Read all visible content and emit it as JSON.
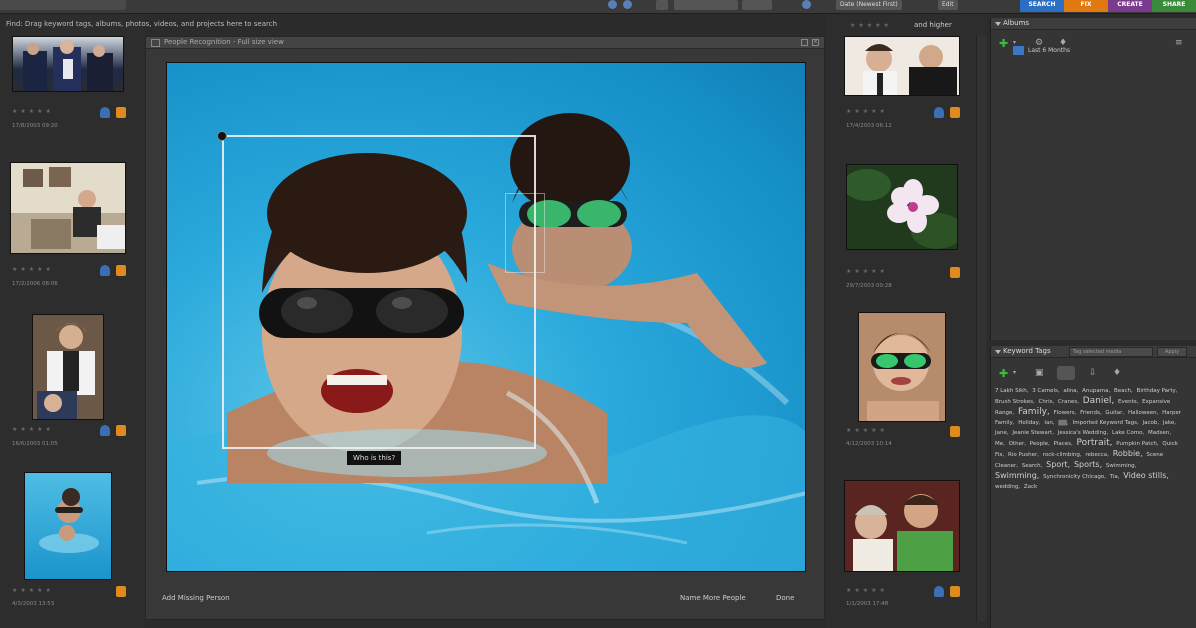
{
  "app": {
    "mode_tabs": [
      {
        "label": "SEARCH",
        "color": "#2a6fc4"
      },
      {
        "label": "FIX",
        "color": "#e07a10"
      },
      {
        "label": "CREATE",
        "color": "#7a3a8e"
      },
      {
        "label": "SHARE",
        "color": "#3a8a3a"
      }
    ],
    "top_sort_label": "Date (Newest First)",
    "top_edit_label": "Edit"
  },
  "organizer": {
    "drag_hint": "Find: Drag keyword tags, albums, photos, videos, and projects here to search",
    "rating_filter_label": "and higher",
    "stars": "★★★★★"
  },
  "left_thumbs": [
    {
      "date": "17/8/2003 09:20"
    },
    {
      "date": "17/2/2006 08:06"
    },
    {
      "date": "16/6/2003 01:05"
    },
    {
      "date": "4/3/2003 13:53"
    }
  ],
  "right_thumbs": [
    {
      "date": "17/4/2003 06:12"
    },
    {
      "date": "29/7/2003 00:28"
    },
    {
      "date": "4/12/2003 10:14"
    },
    {
      "date": "1/1/2003 17:48"
    }
  ],
  "recognition": {
    "title": "People Recognition - Full size view",
    "who_label": "Who is this?",
    "add_missing_person": "Add Missing Person",
    "name_more_people": "Name More People",
    "done": "Done"
  },
  "albums_panel": {
    "title": "Albums",
    "items": [
      {
        "label": "Last 6 Months"
      }
    ]
  },
  "keywords_panel": {
    "title": "Keyword Tags",
    "search_placeholder": "Tag selected media",
    "apply_label": "Apply",
    "tags": [
      {
        "text": "7 Lakh Sikh,",
        "size": "s"
      },
      {
        "text": "3 Camels,",
        "size": "s"
      },
      {
        "text": "alina,",
        "size": "s"
      },
      {
        "text": "Anupama,",
        "size": "s"
      },
      {
        "text": "Beach,",
        "size": "s"
      },
      {
        "text": "Birthday Party,",
        "size": "s"
      },
      {
        "text": "Brush Strokes,",
        "size": "s"
      },
      {
        "text": "Chris,",
        "size": "s"
      },
      {
        "text": "Cranes,",
        "size": "s"
      },
      {
        "text": "Daniel,",
        "size": "l1"
      },
      {
        "text": "Events,",
        "size": "s"
      },
      {
        "text": "Expansive Range,",
        "size": "s"
      },
      {
        "text": "Family,",
        "size": "l1"
      },
      {
        "text": "Flowers,",
        "size": "s"
      },
      {
        "text": "Friends,",
        "size": "s"
      },
      {
        "text": "Guitar,",
        "size": "s"
      },
      {
        "text": "Halloween,",
        "size": "s"
      },
      {
        "text": "Harper Family,",
        "size": "s"
      },
      {
        "text": "Holiday,",
        "size": "s"
      },
      {
        "text": "Ian,",
        "size": "s"
      },
      {
        "text": "▇▇,",
        "size": "dark"
      },
      {
        "text": "Imported Keyword Tags,",
        "size": "s"
      },
      {
        "text": "Jacob,",
        "size": "s"
      },
      {
        "text": "Jake,",
        "size": "s"
      },
      {
        "text": "Jane,",
        "size": "s"
      },
      {
        "text": "Jeanie Stewart,",
        "size": "s"
      },
      {
        "text": "Jessica's Wedding,",
        "size": "s"
      },
      {
        "text": "Lake Como,",
        "size": "s"
      },
      {
        "text": "Madsen,",
        "size": "s"
      },
      {
        "text": "Me,",
        "size": "s"
      },
      {
        "text": "Other,",
        "size": "s"
      },
      {
        "text": "People,",
        "size": "s"
      },
      {
        "text": "Places,",
        "size": "s"
      },
      {
        "text": "Portrait,",
        "size": "l1"
      },
      {
        "text": "Pumpkin Patch,",
        "size": "s"
      },
      {
        "text": "Quick Fix,",
        "size": "s"
      },
      {
        "text": "Rio Pusher,",
        "size": "s"
      },
      {
        "text": "rock-climbing,",
        "size": "s"
      },
      {
        "text": "rebecca,",
        "size": "s"
      },
      {
        "text": "Robbie,",
        "size": "l3"
      },
      {
        "text": "Scene Cleaner,",
        "size": "s"
      },
      {
        "text": "Search,",
        "size": "s"
      },
      {
        "text": "Sport,",
        "size": "l3"
      },
      {
        "text": "Sports,",
        "size": "l3"
      },
      {
        "text": "Swimming,",
        "size": "s"
      },
      {
        "text": "Swimming,",
        "size": "l3"
      },
      {
        "text": "Synchronicity Chicago,",
        "size": "s"
      },
      {
        "text": "Tia,",
        "size": "s"
      },
      {
        "text": "Video stills,",
        "size": "l3"
      },
      {
        "text": "wedding,",
        "size": "s"
      },
      {
        "text": "Zack",
        "size": "s"
      }
    ]
  }
}
